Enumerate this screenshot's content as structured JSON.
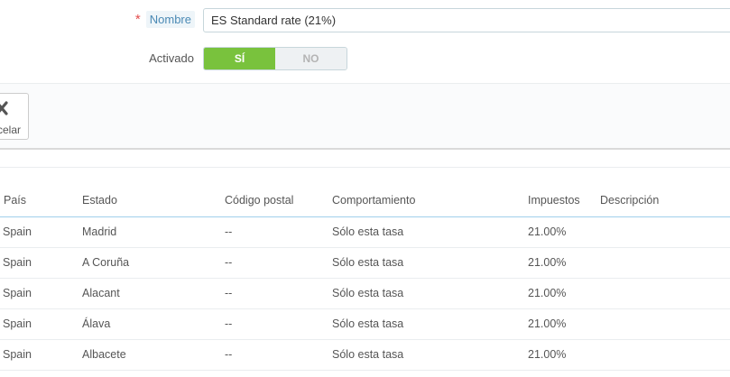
{
  "form": {
    "name_field": {
      "required_marker": "*",
      "label": "Nombre",
      "value": "ES Standard rate (21%)"
    },
    "active_field": {
      "label": "Activado",
      "on_label": "SÍ",
      "off_label": "NO",
      "selected": "SÍ"
    }
  },
  "footer": {
    "cancel_label": "celar",
    "cancel_icon": "close-icon"
  },
  "table": {
    "headers": [
      "País",
      "Estado",
      "Código postal",
      "Comportamiento",
      "Impuestos",
      "Descripción"
    ],
    "rows": [
      {
        "pais": "Spain",
        "estado": "Madrid",
        "codigo_postal": "--",
        "comportamiento": "Sólo esta tasa",
        "impuestos": "21.00%",
        "descripcion": ""
      },
      {
        "pais": "Spain",
        "estado": "A Coruña",
        "codigo_postal": "--",
        "comportamiento": "Sólo esta tasa",
        "impuestos": "21.00%",
        "descripcion": ""
      },
      {
        "pais": "Spain",
        "estado": "Alacant",
        "codigo_postal": "--",
        "comportamiento": "Sólo esta tasa",
        "impuestos": "21.00%",
        "descripcion": ""
      },
      {
        "pais": "Spain",
        "estado": "Álava",
        "codigo_postal": "--",
        "comportamiento": "Sólo esta tasa",
        "impuestos": "21.00%",
        "descripcion": ""
      },
      {
        "pais": "Spain",
        "estado": "Albacete",
        "codigo_postal": "--",
        "comportamiento": "Sólo esta tasa",
        "impuestos": "21.00%",
        "descripcion": ""
      }
    ]
  },
  "colors": {
    "switch_on": "#79c23d",
    "required_star": "#e34d4d",
    "header_underline": "#a0d0eb"
  }
}
